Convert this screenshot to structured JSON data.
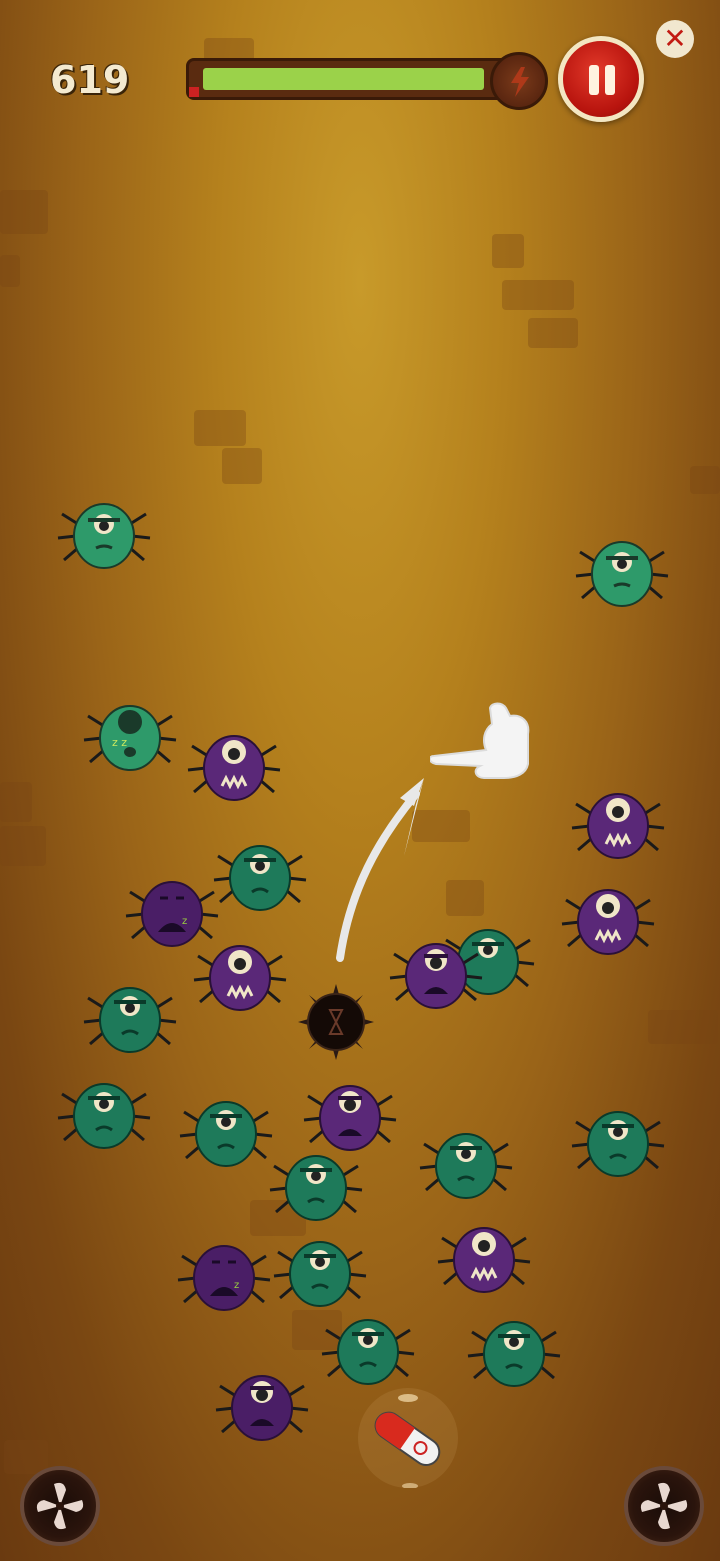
{
  "hud": {
    "score": "619",
    "health_fraction": 0.97,
    "health_bar_fill_color": "#9bd24a",
    "pause_icon": "pause-icon",
    "close_icon": "close-icon",
    "close_symbol": "✕",
    "boost_icon": "lightning-icon"
  },
  "colors": {
    "green_bug": "#2e9a6a",
    "teal_bug": "#1e7a5a",
    "purple_bug": "#5a2878",
    "background_center": "#c89a2a",
    "background_edge": "#6a3a10"
  },
  "tutorial": {
    "hand_icon": "pointing-hand-icon",
    "arrow_icon": "swipe-arrow-icon"
  },
  "powerups": {
    "bomb_icon": "spiked-bomb-icon",
    "pill_icon": "capsule-pill-icon",
    "fan_left_icon": "fan-icon",
    "fan_right_icon": "fan-icon"
  }
}
